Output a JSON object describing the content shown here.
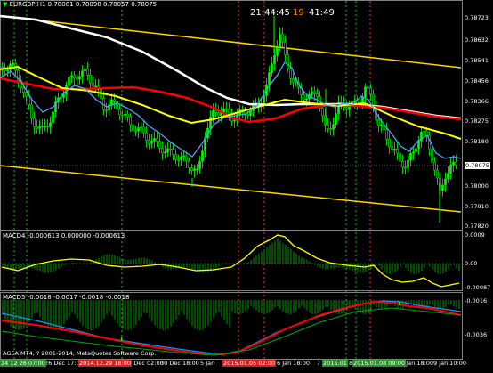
{
  "main": {
    "symbol_label": "EURGBP,H1",
    "ohlc_text": "0.78081 0.78098 0.78057 0.78075",
    "clock_time": "21:44:45",
    "countdown_minutes": "19",
    "countdown_seconds": "41:49",
    "price_labels": [
      "0.78723",
      "0.78632",
      "0.78541",
      "0.78456",
      "0.78366",
      "0.78275",
      "0.78180",
      "0.78075",
      "0.78000",
      "0.77910",
      "0.77820"
    ],
    "current_price": "0.78075"
  },
  "macd4": {
    "label": "MACD4 -0.000613 0.000000 -0.000613",
    "scale_labels": [
      "0.0009",
      "0.00",
      "-0.00087"
    ]
  },
  "macd5": {
    "label": "MACD5 -0.0018 -0.0017 -0.0018 -0.0018",
    "scale_labels": [
      "-0.0016",
      "-0.0036"
    ]
  },
  "footer": {
    "copyright": "AGEA MT4, ? 2001-2014, MetaQuotes Software Corp."
  },
  "time_axis": {
    "labels": [
      "24 Dec 07:00",
      "26 Dec 17:00",
      "29 Dec 18:00",
      "30 Dec 02:00",
      "30 Dec 18:00",
      "5 Jan",
      "5 Jan 02:00",
      "6 Jan 18:00",
      "7",
      "8 Jan 09:00",
      "8 Jan 18:00",
      "9 Jan 10:00"
    ],
    "highlight_labels": [
      "14 12 26 07:00",
      "2014.12.29 18:00",
      "2015.01.05 02:00",
      "2015.01",
      "2015.01.08 09:00"
    ]
  },
  "colors": {
    "background": "#000000",
    "bull_candle": "#00ff00",
    "bear_candle": "#00cc00",
    "ma_fast": "#3fa9f5",
    "ma_mid": "#ffff00",
    "ma_slow": "#ff0000",
    "ma_long": "#ffffff",
    "channel": "#ffd700",
    "grid_vert_red": "#ff3030",
    "grid_vert_green": "#20c020",
    "axis_text": "#ffffff",
    "countdown_color": "#ff8c00",
    "histogram": "#008000",
    "signal_line": "#ffff00",
    "macd5_red": "#ff0000",
    "macd5_blue": "#1e90ff"
  }
}
